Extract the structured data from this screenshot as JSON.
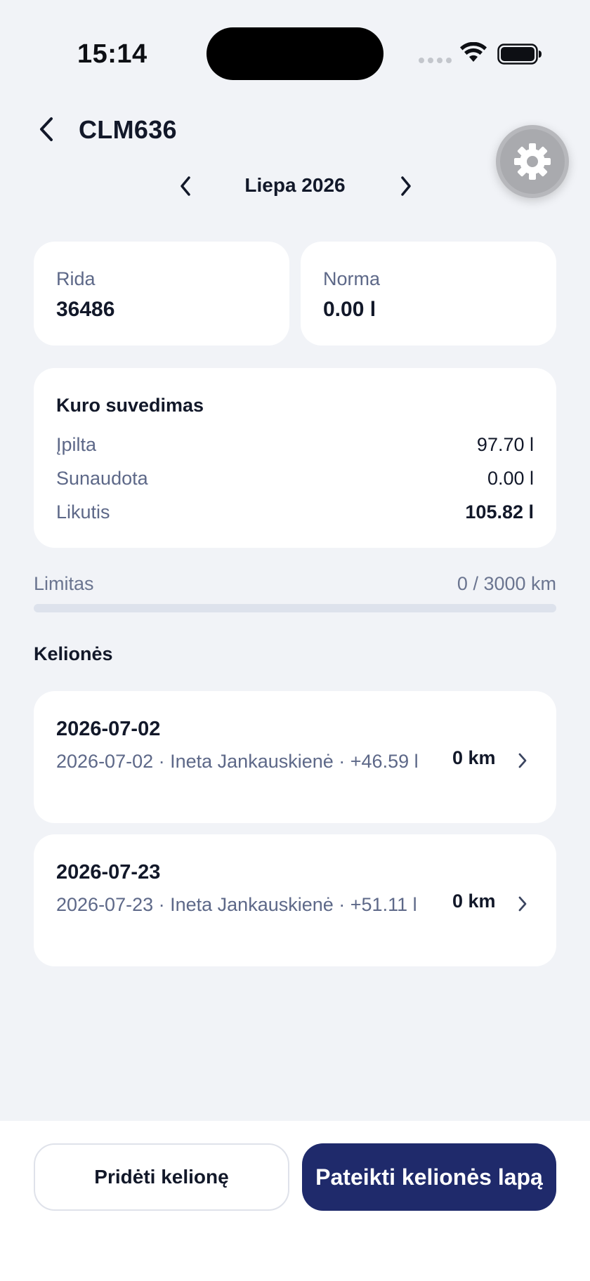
{
  "status_bar": {
    "time": "15:14"
  },
  "header": {
    "title": "CLM636",
    "back_icon": "chevron-left-icon",
    "settings_icon": "gear-icon"
  },
  "month_nav": {
    "label": "Liepa 2026",
    "prev_icon": "chevron-left-icon",
    "next_icon": "chevron-right-icon"
  },
  "stats": [
    {
      "label": "Rida",
      "value": "36486"
    },
    {
      "label": "Norma",
      "value": "0.00 l"
    }
  ],
  "fuel_summary": {
    "title": "Kuro suvedimas",
    "rows": [
      {
        "label": "Įpilta",
        "value": "97.70 l"
      },
      {
        "label": "Sunaudota",
        "value": "0.00 l"
      },
      {
        "label": "Likutis",
        "value": "105.82 l"
      }
    ]
  },
  "limit": {
    "label": "Limitas",
    "value": "0 / 3000 km",
    "used_km": 0,
    "total_km": 3000
  },
  "trips_section": {
    "title": "Kelionės"
  },
  "trips": [
    {
      "date": "2026-07-02",
      "subtitle": "2026-07-02 · Ineta Jankauskienė · +46.59 l",
      "distance": "0 km"
    },
    {
      "date": "2026-07-23",
      "subtitle": "2026-07-23 · Ineta Jankauskienė · +51.11 l",
      "distance": "0 km"
    }
  ],
  "actions": {
    "add_trip": "Pridėti kelionę",
    "submit": "Pateikti kelionės lapą"
  },
  "colors": {
    "background": "#f1f3f7",
    "primary": "#1f2a6b",
    "muted_text": "#5d6888"
  }
}
